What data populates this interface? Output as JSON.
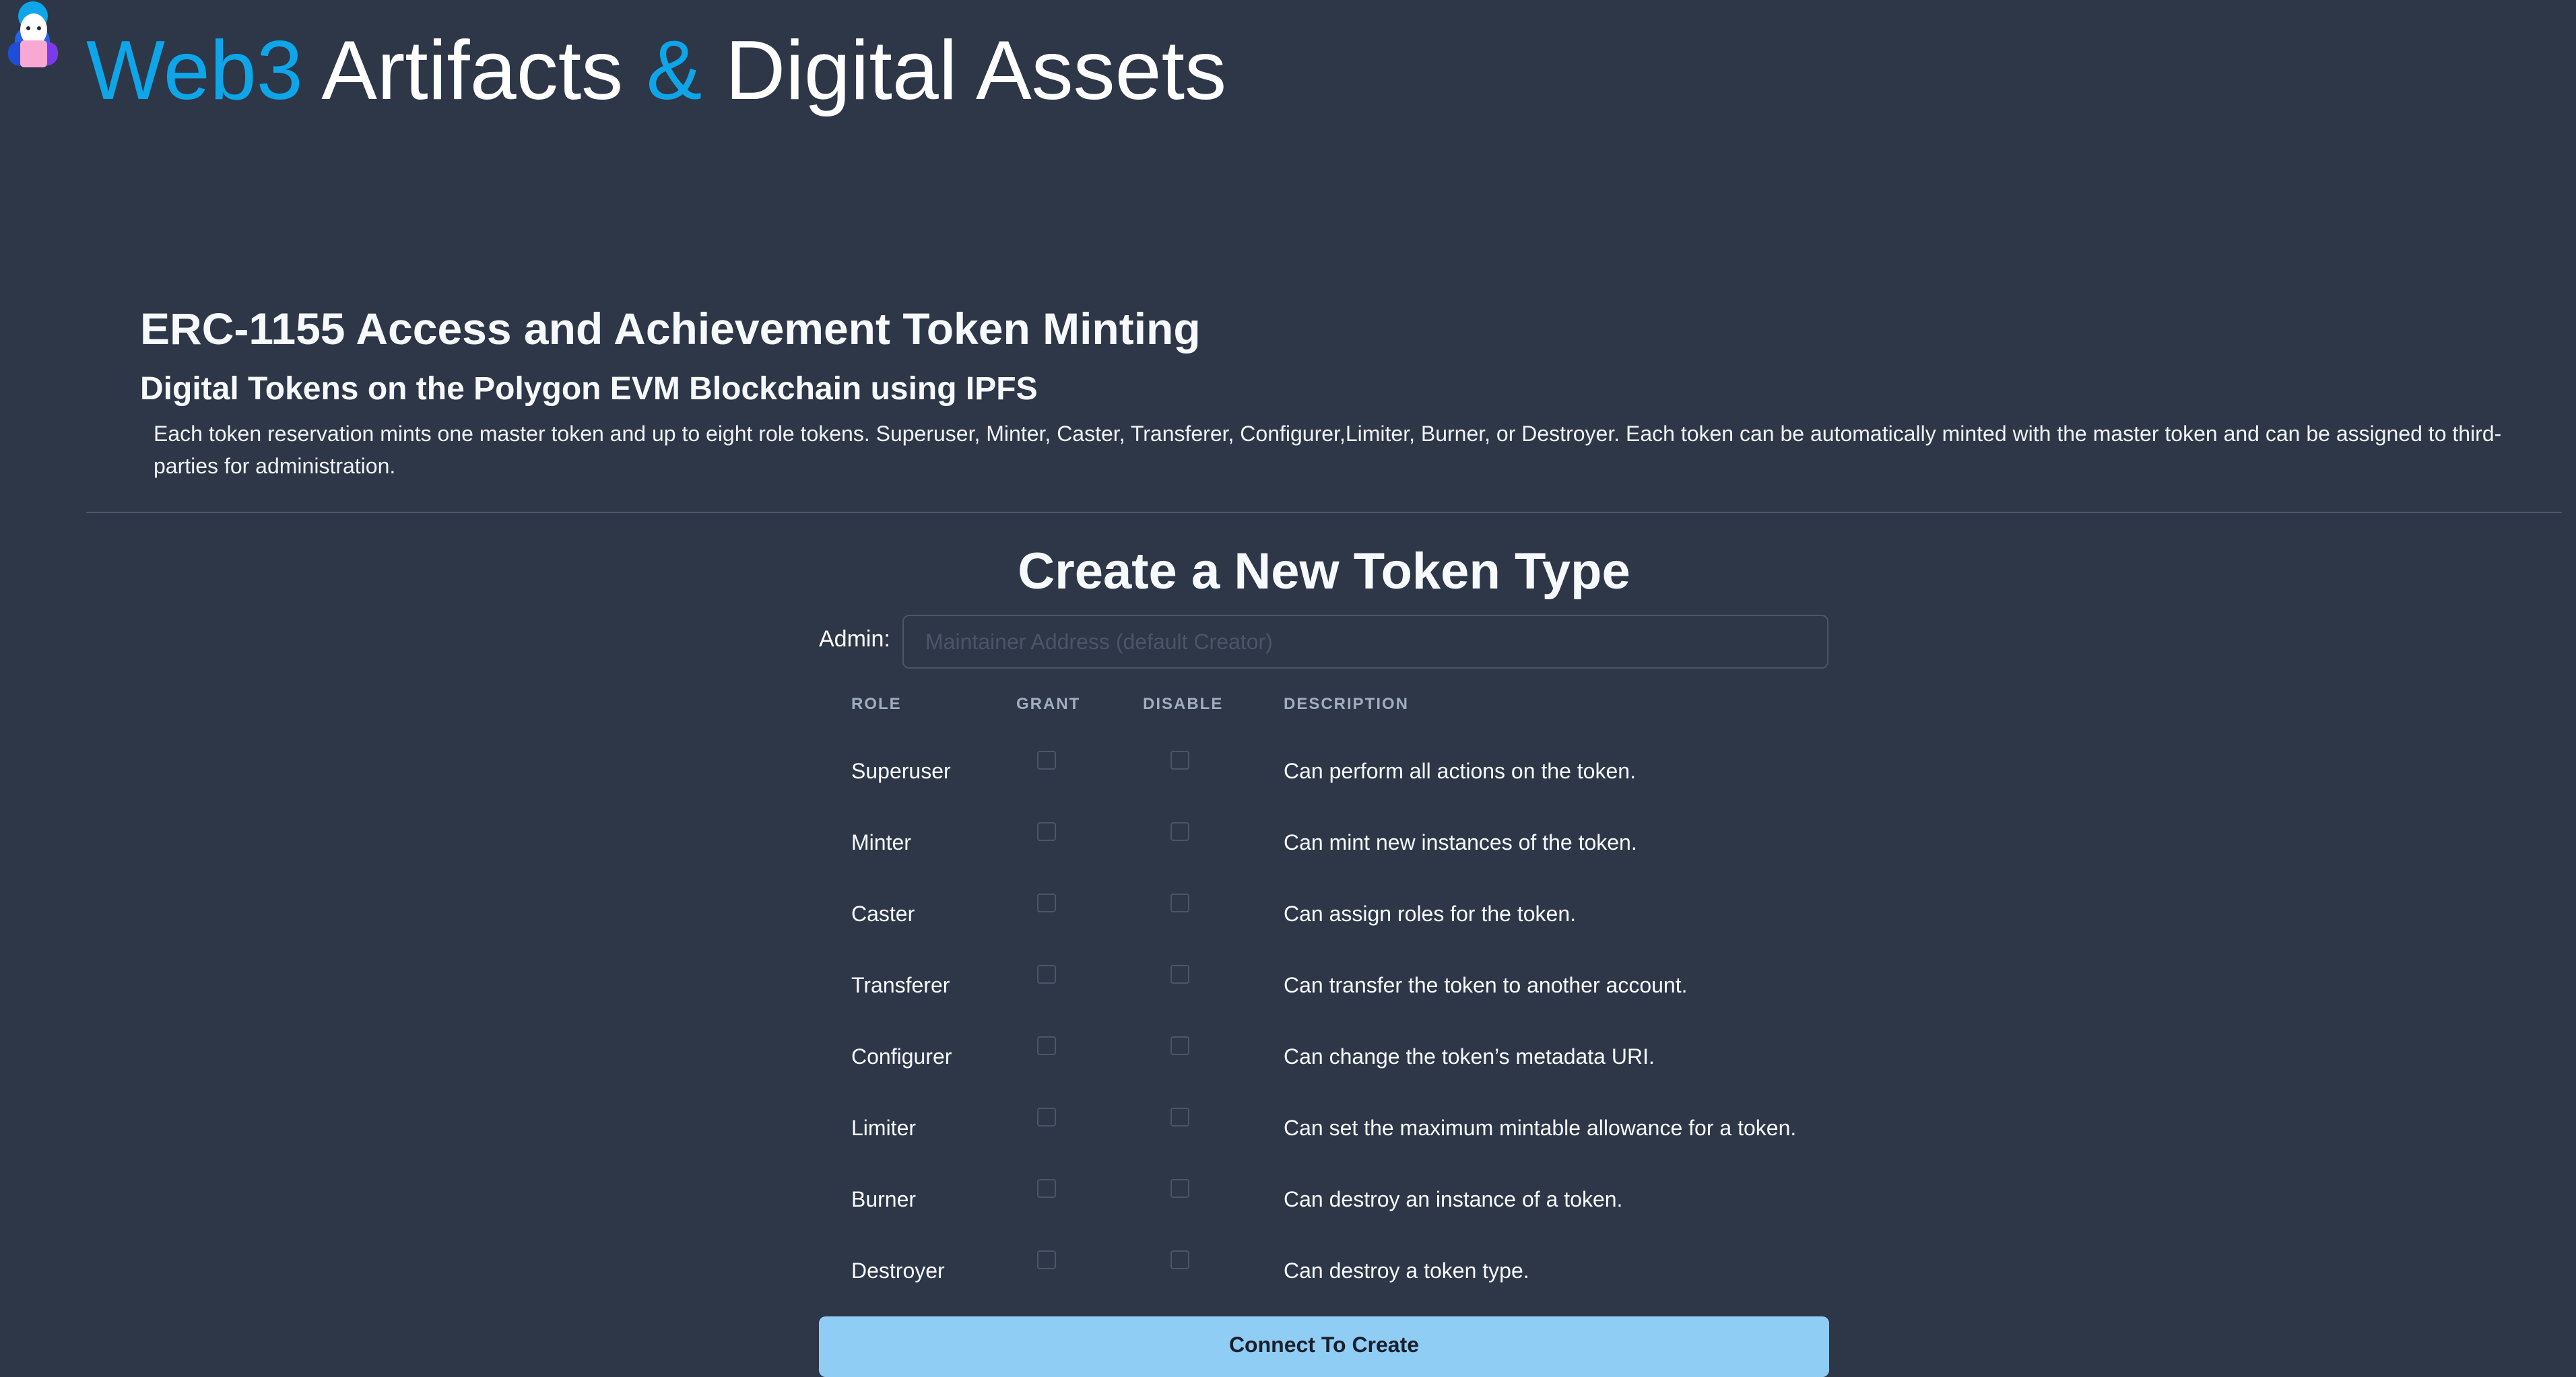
{
  "header": {
    "title_part1": "Web3",
    "title_part2": " Artifacts ",
    "title_part3": "&",
    "title_part4": " Digital Assets",
    "accent_color": "#0ea5e9",
    "logo_icon": "avatar-logo-icon"
  },
  "intro": {
    "title": "ERC-1155 Access and Achievement Token Minting",
    "subtitle": "Digital Tokens on the Polygon EVM Blockchain using IPFS",
    "description": "Each token reservation mints one master token and up to eight role tokens. Superuser, Minter, Caster, Transferer, Configurer,Limiter, Burner, or Destroyer. Each token can be automatically minted with the master token and can be assigned to third-parties for administration."
  },
  "form": {
    "title": "Create a New Token Type",
    "admin_label": "Admin:",
    "admin_placeholder": "Maintainer Address (default Creator)",
    "admin_value": "",
    "columns": [
      "ROLE",
      "GRANT",
      "DISABLE",
      "DESCRIPTION"
    ],
    "roles": [
      {
        "role": "Superuser",
        "grant": false,
        "disable": false,
        "description": "Can perform all actions on the token."
      },
      {
        "role": "Minter",
        "grant": false,
        "disable": false,
        "description": "Can mint new instances of the token."
      },
      {
        "role": "Caster",
        "grant": false,
        "disable": false,
        "description": "Can assign roles for the token."
      },
      {
        "role": "Transferer",
        "grant": false,
        "disable": false,
        "description": "Can transfer the token to another account."
      },
      {
        "role": "Configurer",
        "grant": false,
        "disable": false,
        "description": "Can change the token’s metadata URI."
      },
      {
        "role": "Limiter",
        "grant": false,
        "disable": false,
        "description": "Can set the maximum mintable allowance for a token."
      },
      {
        "role": "Burner",
        "grant": false,
        "disable": false,
        "description": "Can destroy an instance of a token."
      },
      {
        "role": "Destroyer",
        "grant": false,
        "disable": false,
        "description": "Can destroy a token type."
      }
    ],
    "submit_label": "Connect To Create",
    "submit_color": "#90cdf4"
  },
  "colors": {
    "background": "#2d3748",
    "border": "#4a5568",
    "muted_text": "#a0aec0"
  }
}
